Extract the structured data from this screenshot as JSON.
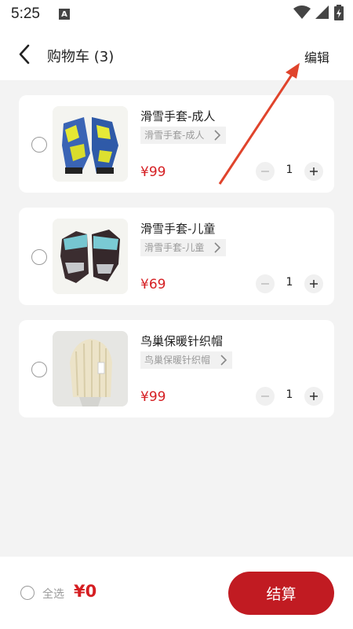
{
  "status_bar": {
    "time": "5:25",
    "notif_icon_letter": "A"
  },
  "header": {
    "title": "购物车",
    "count": "(3)",
    "edit_label": "编辑"
  },
  "cart": {
    "items": [
      {
        "name": "滑雪手套-成人",
        "spec": "滑雪手套-成人",
        "price": "¥99",
        "quantity": "1",
        "image": "ski-gloves-adult"
      },
      {
        "name": "滑雪手套-儿童",
        "spec": "滑雪手套-儿童",
        "price": "¥69",
        "quantity": "1",
        "image": "ski-gloves-kids"
      },
      {
        "name": "鸟巢保暖针织帽",
        "spec": "鸟巢保暖针织帽",
        "price": "¥99",
        "quantity": "1",
        "image": "knit-hat"
      }
    ]
  },
  "footer": {
    "select_all_label": "全选",
    "total": "¥0",
    "checkout_label": "结算"
  },
  "colors": {
    "accent": "#c11b22",
    "price": "#d51e22",
    "background": "#f3f3f3"
  }
}
